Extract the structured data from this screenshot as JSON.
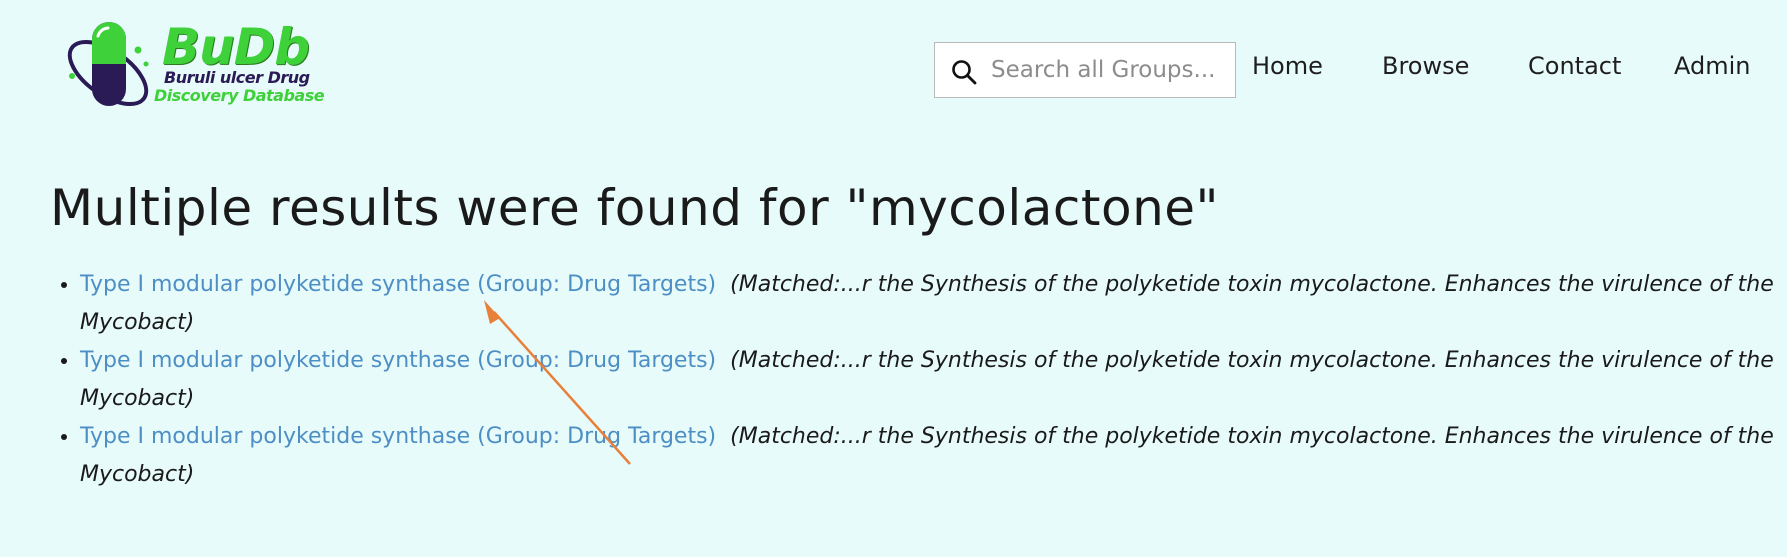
{
  "header": {
    "logo": {
      "title": "BuDb",
      "line1": "Buruli ulcer Drug",
      "line2": "Discovery Database"
    },
    "search": {
      "placeholder": "Search all Groups...",
      "value": ""
    },
    "nav": [
      {
        "label": "Home"
      },
      {
        "label": "Browse"
      },
      {
        "label": "Contact"
      },
      {
        "label": "Admin"
      }
    ]
  },
  "main": {
    "title": "Multiple results were found for \"mycolactone\"",
    "results": [
      {
        "link": "Type I modular polyketide synthase (Group: Drug Targets)",
        "match": "(Matched:...r the Synthesis of the polyketide toxin mycolactone. Enhances the virulence of the Mycobact)"
      },
      {
        "link": "Type I modular polyketide synthase (Group: Drug Targets)",
        "match": "(Matched:...r the Synthesis of the polyketide toxin mycolactone. Enhances the virulence of the Mycobact)"
      },
      {
        "link": "Type I modular polyketide synthase (Group: Drug Targets)",
        "match": "(Matched:...r the Synthesis of the polyketide toxin mycolactone. Enhances the virulence of the Mycobact)"
      }
    ]
  },
  "colors": {
    "background": "#e8fbfb",
    "link": "#4d8fc4",
    "logo_green": "#3ed13a",
    "logo_purple": "#2a1a55",
    "annotation_arrow": "#e8803a"
  }
}
